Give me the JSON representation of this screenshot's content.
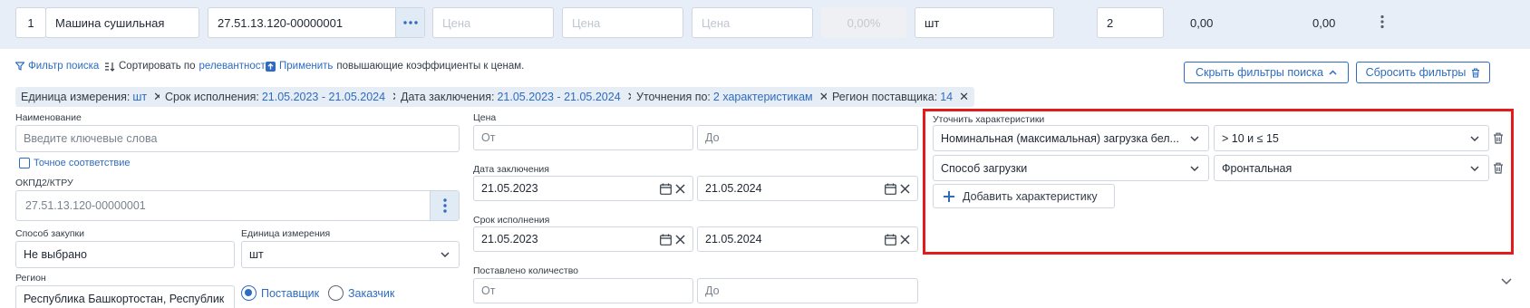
{
  "item_row": {
    "number": "1",
    "name": "Машина сушильная",
    "code": "27.51.13.120-00000001",
    "price_placeholder": "Цена",
    "percent": "0,00%",
    "unit": "шт",
    "quantity": "2",
    "sum1": "0,00",
    "sum2": "0,00"
  },
  "actions": {
    "search_filter": "Фильтр поиска",
    "sort_prefix": "Сортировать по",
    "sort_value": "релевантности",
    "apply": "Применить",
    "apply_suffix": "повышающие коэффициенты к ценам.",
    "hide_filters": "Скрыть фильтры поиска",
    "reset_filters": "Сбросить фильтры"
  },
  "chips": [
    {
      "label": "Единица измерения:",
      "value": "шт"
    },
    {
      "label": "Срок исполнения:",
      "value": "21.05.2023 - 21.05.2024"
    },
    {
      "label": "Дата заключения:",
      "value": "21.05.2023 - 21.05.2024"
    },
    {
      "label": "Уточнения по:",
      "value": "2 характеристикам"
    },
    {
      "label": "Регион поставщика:",
      "value": "14"
    }
  ],
  "form": {
    "name_label": "Наименование",
    "name_placeholder": "Введите ключевые слова",
    "exact_match": "Точное соответствие",
    "okpd_label": "ОКПД2/КТРУ",
    "okpd_value": "27.51.13.120-00000001",
    "purchase_method_label": "Способ закупки",
    "purchase_method_value": "Не выбрано",
    "unit_label": "Единица измерения",
    "unit_value": "шт",
    "region_label": "Регион",
    "region_value": "Республика Башкортостан, Республик",
    "radio_supplier": "Поставщик",
    "radio_customer": "Заказчик",
    "price_label": "Цена",
    "from_placeholder": "От",
    "to_placeholder": "До",
    "contract_date_label": "Дата заключения",
    "contract_date_from": "21.05.2023",
    "contract_date_to": "21.05.2024",
    "exec_term_label": "Срок исполнения",
    "exec_term_from": "21.05.2023",
    "exec_term_to": "21.05.2024",
    "delivered_qty_label": "Поставлено количество"
  },
  "characteristics": {
    "label": "Уточнить характеристики",
    "rows": [
      {
        "name": "Номинальная (максимальная) загрузка бел...",
        "value": "> 10 и ≤ 15"
      },
      {
        "name": "Способ загрузки",
        "value": "Фронтальная"
      }
    ],
    "add_button": "Добавить характеристику"
  },
  "colors": {
    "accent": "#2d6cc0",
    "highlight_border": "#e41b1b",
    "top_row_bg": "#e7eef7",
    "chip_bg": "#e7edf5"
  }
}
